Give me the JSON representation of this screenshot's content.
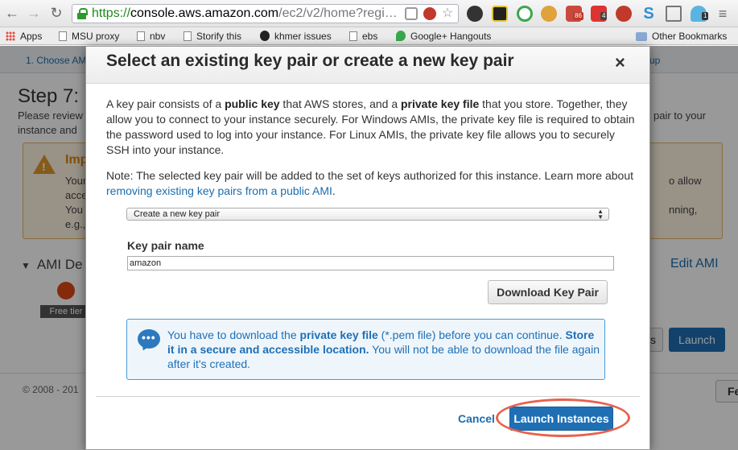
{
  "browser": {
    "url_scheme": "https://",
    "url_host": "console.aws.amazon.com",
    "url_rest": "/ec2/v2/home?regi…",
    "extension_badges": {
      "mail": "86",
      "lastpass": "4",
      "ghostery": "1"
    }
  },
  "bookmarks": [
    {
      "label": "Apps",
      "icon": "apps-icon"
    },
    {
      "label": "MSU proxy",
      "icon": "page-icon"
    },
    {
      "label": "nbv",
      "icon": "page-icon"
    },
    {
      "label": "Storify this",
      "icon": "page-icon"
    },
    {
      "label": "khmer issues",
      "icon": "github-icon"
    },
    {
      "label": "ebs",
      "icon": "page-icon"
    },
    {
      "label": "Google+ Hangouts",
      "icon": "hangouts-icon"
    }
  ],
  "other_bookmarks": "Other Bookmarks",
  "background_page": {
    "wizard_step": "1. Choose AMI",
    "wizard_step_right": "up",
    "heading": "Step 7:",
    "review_lines": [
      "Please review",
      "instance and"
    ],
    "review_right": "pair to your",
    "warning_title": "Imp",
    "warning_lines": [
      "Your",
      "acce",
      "You",
      "e.g.,"
    ],
    "warning_right_lines": [
      "o allow",
      "",
      "nning,"
    ],
    "ami_section": "AMI De",
    "edit_ami": "Edit AMI",
    "free_tier": "Free tier",
    "prev_button": "s",
    "launch_button": "Launch",
    "copyright": "© 2008 - 201",
    "feedback_button": "Fe"
  },
  "modal": {
    "title": "Select an existing key pair or create a new key pair",
    "close": "×",
    "intro_1": "A key pair consists of a ",
    "intro_public_key": "public key",
    "intro_2": " that AWS stores, and a ",
    "intro_private_key": "private key file",
    "intro_3": " that you store. Together, they allow you to connect to your instance securely. For Windows AMIs, the private key file is required to obtain the password used to log into your instance. For Linux AMIs, the private key file allows you to securely SSH into your instance.",
    "note_text": "Note: The selected key pair will be added to the set of keys authorized for this instance. Learn more about ",
    "note_link": "removing existing key pairs from a public AMI",
    "note_end": ".",
    "key_pair_select": "Create a new key pair",
    "key_pair_name_label": "Key pair name",
    "key_pair_name_value": "amazon",
    "download_button": "Download Key Pair",
    "info_1": "You have to download the ",
    "info_private_key": "private key file",
    "info_2": " (*.pem file) before you can continue. ",
    "info_store": "Store it in a secure and accessible location.",
    "info_3": " You will not be able to download the file again after it's created.",
    "cancel": "Cancel",
    "launch_instances": "Launch Instances"
  }
}
